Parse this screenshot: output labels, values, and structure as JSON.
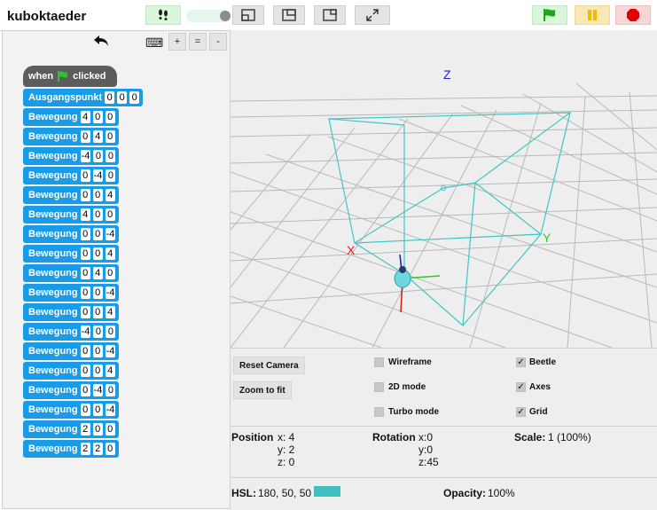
{
  "title": "kuboktaeder",
  "toolbar": {
    "icons": [
      "footprints-icon",
      "slider-toggle",
      "layout-normal-icon",
      "layout-stage-icon",
      "layout-small-icon",
      "fullscreen-icon",
      "green-flag-icon",
      "pause-icon",
      "stop-icon"
    ],
    "colors": {
      "flag_bg": "#d9f7d9",
      "pause_bg": "#f8e8b4",
      "stop_bg": "#f9d6d6",
      "flag": "#1aa91a",
      "pause": "#f5b800",
      "stop": "#e00000"
    }
  },
  "palette": {
    "keyboard": "⌨",
    "plus": "+",
    "equals": "=",
    "minus": "-"
  },
  "script": {
    "hat": {
      "when": "when",
      "clicked": "clicked"
    },
    "blocks": [
      {
        "label": "Ausgangspunkt",
        "args": [
          "0",
          "0",
          "0"
        ]
      },
      {
        "label": "Bewegung",
        "args": [
          "4",
          "0",
          "0"
        ]
      },
      {
        "label": "Bewegung",
        "args": [
          "0",
          "4",
          "0"
        ]
      },
      {
        "label": "Bewegung",
        "args": [
          "-4",
          "0",
          "0"
        ]
      },
      {
        "label": "Bewegung",
        "args": [
          "0",
          "-4",
          "0"
        ]
      },
      {
        "label": "Bewegung",
        "args": [
          "0",
          "0",
          "4"
        ]
      },
      {
        "label": "Bewegung",
        "args": [
          "4",
          "0",
          "0"
        ]
      },
      {
        "label": "Bewegung",
        "args": [
          "0",
          "0",
          "-4"
        ]
      },
      {
        "label": "Bewegung",
        "args": [
          "0",
          "0",
          "4"
        ]
      },
      {
        "label": "Bewegung",
        "args": [
          "0",
          "4",
          "0"
        ]
      },
      {
        "label": "Bewegung",
        "args": [
          "0",
          "0",
          "-4"
        ]
      },
      {
        "label": "Bewegung",
        "args": [
          "0",
          "0",
          "4"
        ]
      },
      {
        "label": "Bewegung",
        "args": [
          "-4",
          "0",
          "0"
        ]
      },
      {
        "label": "Bewegung",
        "args": [
          "0",
          "0",
          "-4"
        ]
      },
      {
        "label": "Bewegung",
        "args": [
          "0",
          "0",
          "4"
        ]
      },
      {
        "label": "Bewegung",
        "args": [
          "0",
          "-4",
          "0"
        ]
      },
      {
        "label": "Bewegung",
        "args": [
          "0",
          "0",
          "-4"
        ]
      },
      {
        "label": "Bewegung",
        "args": [
          "2",
          "0",
          "0"
        ]
      },
      {
        "label": "Bewegung",
        "args": [
          "2",
          "2",
          "0"
        ]
      }
    ]
  },
  "viewport": {
    "axis_x": "X",
    "axis_y": "Y",
    "axis_z": "Z"
  },
  "controls": {
    "reset_camera": "Reset Camera",
    "zoom_to_fit": "Zoom to fit",
    "wireframe": {
      "label": "Wireframe",
      "checked": false
    },
    "mode_2d": {
      "label": "2D mode",
      "checked": false
    },
    "turbo": {
      "label": "Turbo mode",
      "checked": false
    },
    "beetle": {
      "label": "Beetle",
      "checked": true
    },
    "axes": {
      "label": "Axes",
      "checked": true
    },
    "grid": {
      "label": "Grid",
      "checked": true
    }
  },
  "status": {
    "position_label": "Position",
    "pos_x": "x: 4",
    "pos_y": "y: 2",
    "pos_z": "z: 0",
    "rotation_label": "Rotation",
    "rot_x": "x:0",
    "rot_y": "y:0",
    "rot_z": "z:45",
    "scale_label": "Scale:",
    "scale_value": "1 (100%)",
    "hsl_label": "HSL:",
    "hsl_value": "180, 50, 50",
    "hsl_color": "#40bfbf",
    "opacity_label": "Opacity:",
    "opacity_value": "100%"
  }
}
